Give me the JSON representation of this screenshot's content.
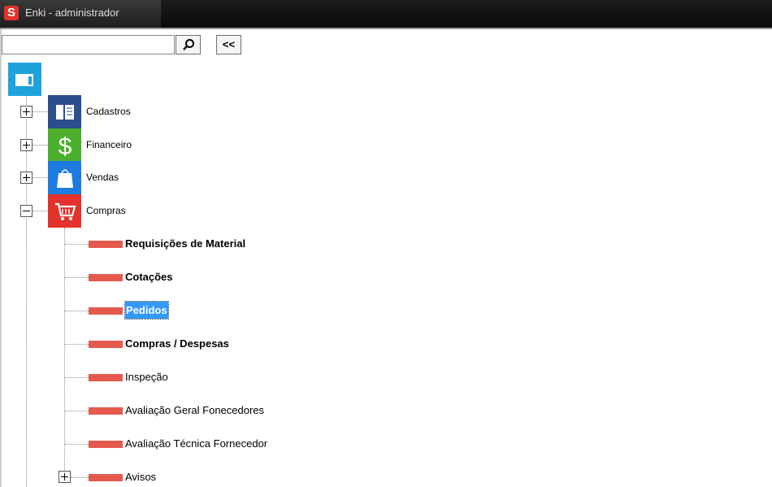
{
  "window": {
    "title": "Enki - administrador"
  },
  "search": {
    "value": "",
    "placeholder": "",
    "collapse_label": "<<"
  },
  "tree": {
    "categories": [
      {
        "label": "Cadastros",
        "icon": "book-icon",
        "color": "#2b4e8c",
        "expanded": false
      },
      {
        "label": "Financeiro",
        "icon": "dollar-icon",
        "color": "#4caf2e",
        "expanded": false
      },
      {
        "label": "Vendas",
        "icon": "shopping-bag-icon",
        "color": "#1e7be0",
        "expanded": false
      },
      {
        "label": "Compras",
        "icon": "shopping-cart-icon",
        "color": "#e4312b",
        "expanded": true
      }
    ],
    "compras_children": [
      {
        "label": "Requisições de Material",
        "style": "bold"
      },
      {
        "label": "Cotações",
        "style": "bold"
      },
      {
        "label": "Pedidos",
        "style": "selected"
      },
      {
        "label": "Compras / Despesas",
        "style": "bold"
      },
      {
        "label": "Inspeção",
        "style": "normal"
      },
      {
        "label": "Avaliação Geral Fonecedores",
        "style": "normal"
      },
      {
        "label": "Avaliação Técnica Fornecedor",
        "style": "normal"
      },
      {
        "label": "Avisos",
        "style": "normal",
        "has_children": true
      }
    ]
  },
  "colors": {
    "accent": "#3399ff",
    "item_bar": "#e45a4f",
    "root_icon": "#1ea2dc"
  }
}
